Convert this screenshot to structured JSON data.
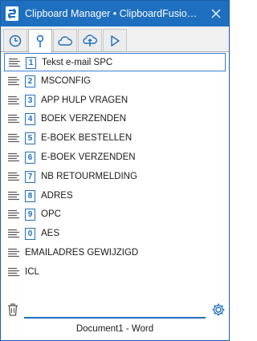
{
  "window": {
    "title": "Clipboard Manager • ClipboardFusion 5....",
    "accent_color": "#1e6fbf"
  },
  "tabs": [
    {
      "icon": "clock-icon",
      "selected": false
    },
    {
      "icon": "pin-icon",
      "selected": true
    },
    {
      "icon": "cloud-icon",
      "selected": false
    },
    {
      "icon": "cloud-sync-icon",
      "selected": false
    },
    {
      "icon": "play-icon",
      "selected": false
    }
  ],
  "items": [
    {
      "num": "1",
      "label": "Tekst e-mail SPC",
      "selected": true
    },
    {
      "num": "2",
      "label": "MSCONFIG"
    },
    {
      "num": "3",
      "label": "APP HULP VRAGEN"
    },
    {
      "num": "4",
      "label": "BOEK VERZENDEN"
    },
    {
      "num": "5",
      "label": "E-BOEK BESTELLEN"
    },
    {
      "num": "6",
      "label": "E-BOEK VERZENDEN"
    },
    {
      "num": "7",
      "label": "NB RETOURMELDING"
    },
    {
      "num": "8",
      "label": "ADRES"
    },
    {
      "num": "9",
      "label": "OPC"
    },
    {
      "num": "0",
      "label": "AES"
    },
    {
      "num": "",
      "label": "EMAILADRES GEWIJZIGD"
    },
    {
      "num": "",
      "label": "ICL"
    }
  ],
  "search": {
    "value": "",
    "placeholder": ""
  },
  "status": {
    "text": "Document1 - Word"
  }
}
